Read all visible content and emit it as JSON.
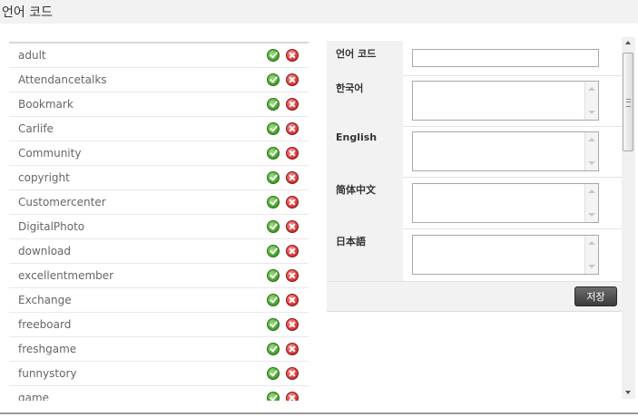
{
  "header": {
    "title": "언어 코드"
  },
  "list": {
    "items": [
      {
        "name": "adult"
      },
      {
        "name": "Attendancetalks"
      },
      {
        "name": "Bookmark"
      },
      {
        "name": "Carlife"
      },
      {
        "name": "Community"
      },
      {
        "name": "copyright"
      },
      {
        "name": "Customercenter"
      },
      {
        "name": "DigitalPhoto"
      },
      {
        "name": "download"
      },
      {
        "name": "excellentmember"
      },
      {
        "name": "Exchange"
      },
      {
        "name": "freeboard"
      },
      {
        "name": "freshgame"
      },
      {
        "name": "funnystory"
      },
      {
        "name": "game"
      }
    ],
    "icons": {
      "confirm": "check-circle-icon",
      "delete": "x-circle-icon"
    }
  },
  "form": {
    "code_label": "언어 코드",
    "code_value": "",
    "fields": [
      {
        "label": "한국어",
        "value": ""
      },
      {
        "label": "English",
        "value": ""
      },
      {
        "label": "简体中文",
        "value": ""
      },
      {
        "label": "日本語",
        "value": ""
      }
    ],
    "save_label": "저장"
  },
  "colors": {
    "confirm": "#4aa92f",
    "delete": "#dd3b3b",
    "button": "#4a4a4a",
    "label_bg": "#f2f2f2"
  }
}
